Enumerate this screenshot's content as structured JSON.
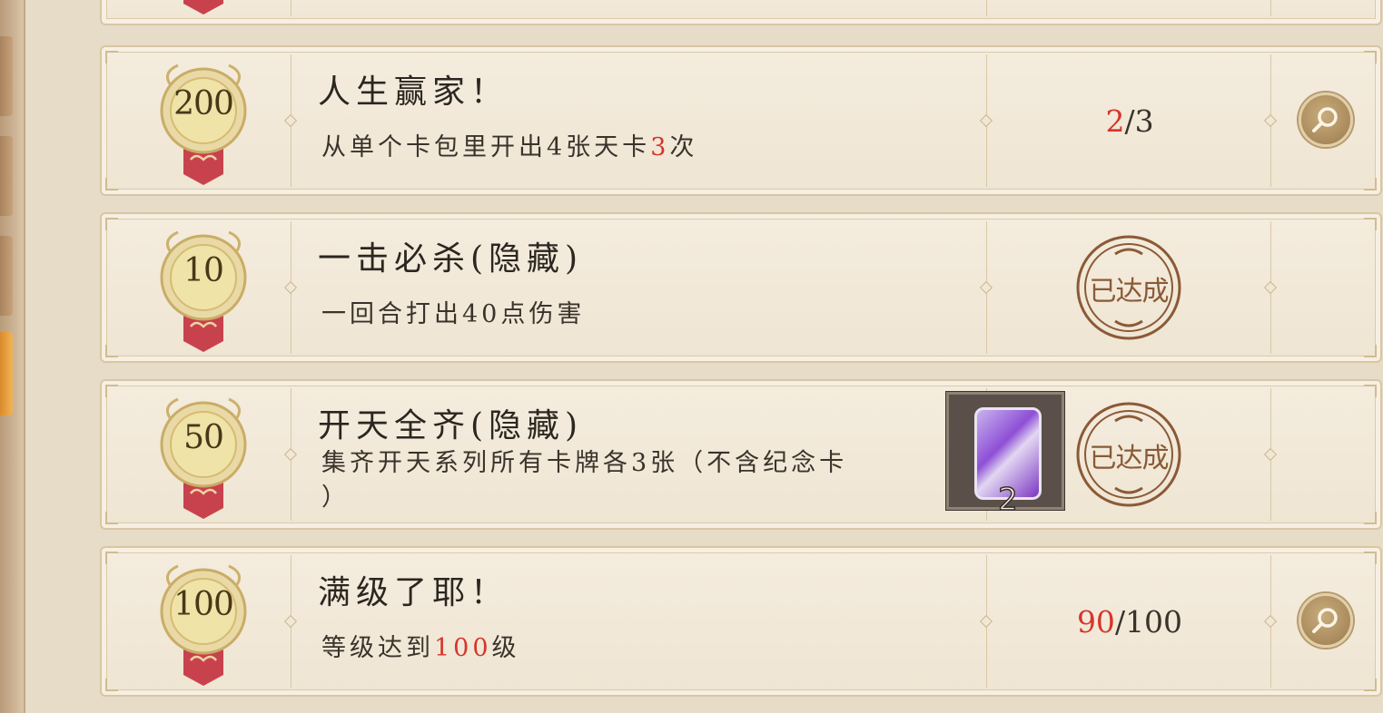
{
  "achievements": [
    {
      "points": "200",
      "title": "人生赢家！",
      "description_pre": "从单个卡包里开出4张天卡",
      "description_highlight": "3",
      "description_post": "次",
      "progress_current": "2",
      "progress_sep": "/",
      "progress_total": "3",
      "status": "in-progress"
    },
    {
      "points": "10",
      "title": "一击必杀(隐藏)",
      "description_pre": "一回合打出40点伤害",
      "status": "completed",
      "stamp_label": "已达成"
    },
    {
      "points": "50",
      "title": "开天全齐(隐藏)",
      "description_pre": "集齐开天系列所有卡牌各3张（不含纪念卡",
      "description_line2": "）",
      "reward_qty": "2",
      "status": "completed",
      "stamp_label": "已达成"
    },
    {
      "points": "100",
      "title": "满级了耶！",
      "description_pre": "等级达到",
      "description_highlight": "100",
      "description_post": "级",
      "progress_current": "90",
      "progress_sep": "/",
      "progress_total": "100",
      "status": "in-progress"
    }
  ],
  "icons": {
    "medal": "medal-badge-icon",
    "detail": "magnifier-icon",
    "stamp": "completed-stamp-icon",
    "reward": "card-pack-icon"
  },
  "colors": {
    "highlight": "#d6352a",
    "stamp": "#8a5a36",
    "ribbon": "#c8424d",
    "medal_gold": "#e6cf7e"
  }
}
